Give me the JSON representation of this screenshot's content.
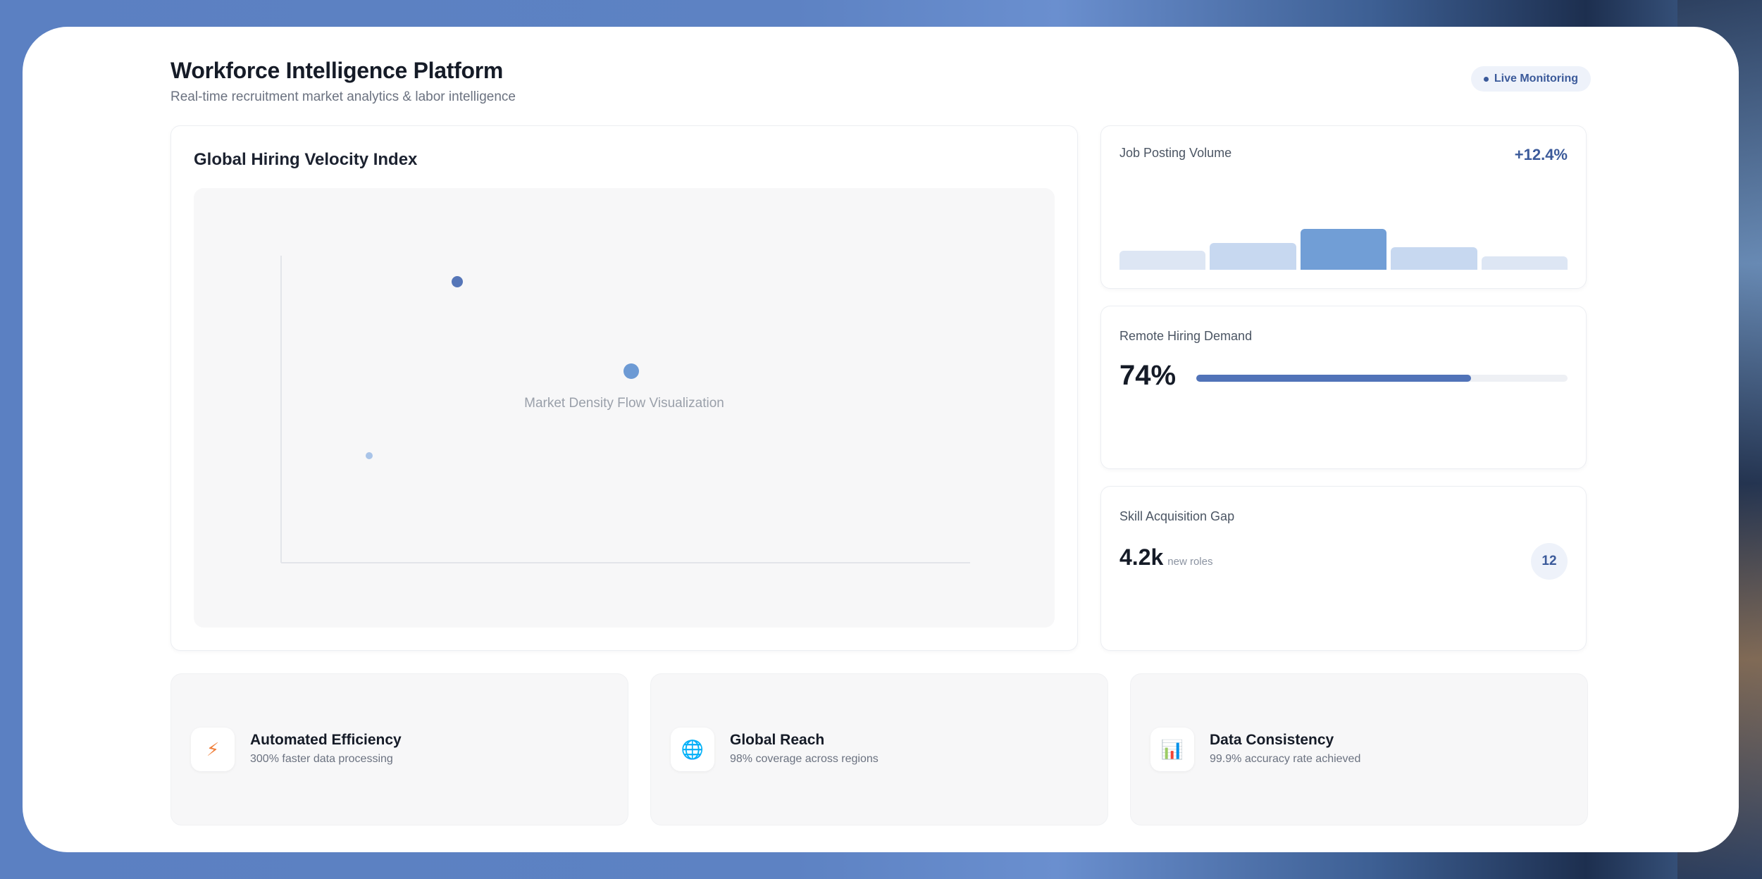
{
  "header": {
    "title": "Workforce Intelligence Platform",
    "subtitle": "Real-time recruitment market analytics & labor intelligence",
    "live_badge": "Live Monitoring"
  },
  "main": {
    "title": "Global Hiring Velocity Index",
    "plot_caption": "Market Density Flow Visualization"
  },
  "job_posting": {
    "label": "Job Posting Volume",
    "growth": "+12.4%",
    "bars": [
      0.34,
      0.48,
      0.72,
      0.4,
      0.24
    ],
    "bar_colors": [
      "#dde6f4",
      "#c7d8f0",
      "#719ed6",
      "#c7d8f0",
      "#dde6f4"
    ]
  },
  "remote": {
    "label": "Remote Hiring Demand",
    "value": "74%",
    "fraction": 0.74
  },
  "skill": {
    "label": "Skill Acquisition Gap",
    "value": "4.2k",
    "unit": "new roles",
    "badge": "12"
  },
  "features": [
    {
      "icon": "lightning-icon",
      "glyph": "⚡",
      "title": "Automated Efficiency",
      "desc": "300% faster data processing"
    },
    {
      "icon": "globe-icon",
      "glyph": "🌐",
      "title": "Global Reach",
      "desc": "98% coverage across regions"
    },
    {
      "icon": "bar-chart-icon",
      "glyph": "📊",
      "title": "Data Consistency",
      "desc": "99.9% accuracy rate achieved"
    }
  ],
  "colors": {
    "accent": "#3b5a9a",
    "progress": "#5173b8",
    "dot_dark": "#5676b8",
    "dot_mid": "#6d9ad4",
    "dot_light": "#a9c4e8"
  }
}
